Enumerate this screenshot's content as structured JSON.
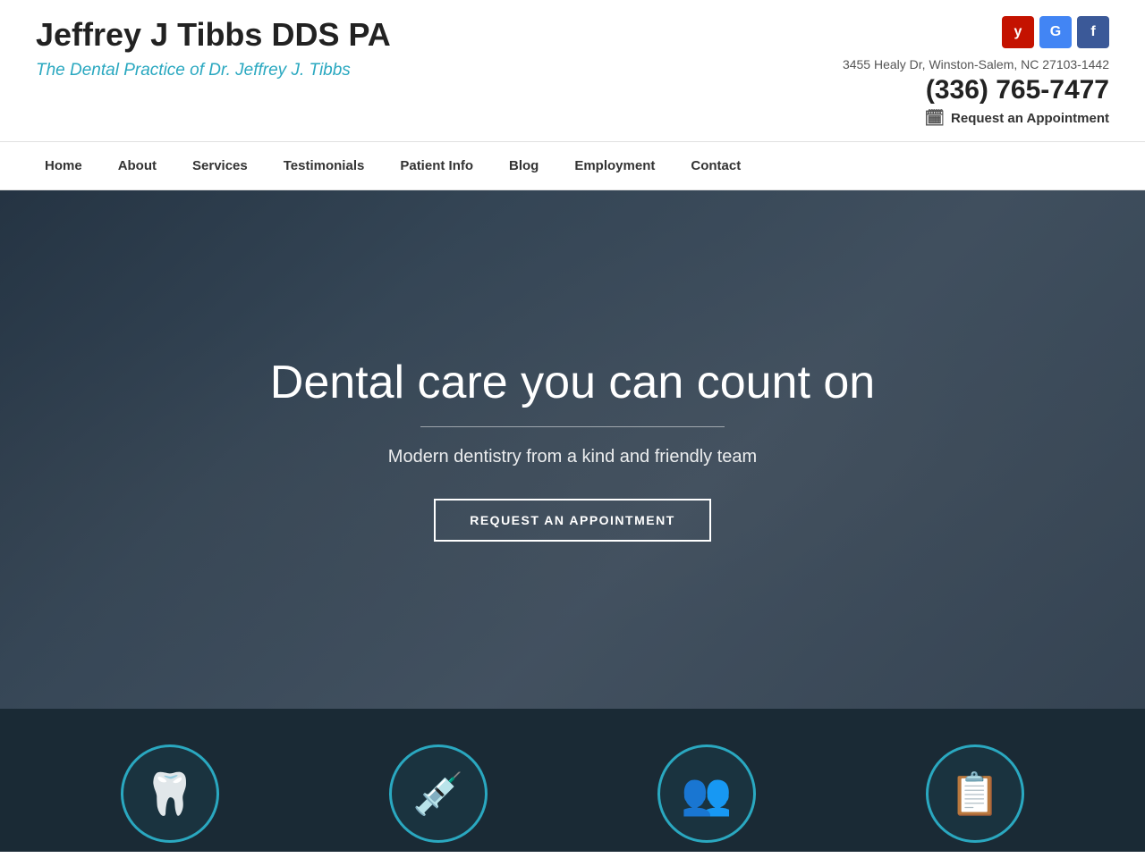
{
  "header": {
    "logo_title": "Jeffrey J Tibbs DDS PA",
    "logo_subtitle": "The Dental Practice of Dr. Jeffrey J. Tibbs",
    "address": "3455 Healy Dr, Winston-Salem, NC 27103-1442",
    "phone": "(336) 765-7477",
    "appointment_label": "Request an Appointment",
    "social": {
      "yelp_label": "y",
      "google_label": "G",
      "facebook_label": "f"
    }
  },
  "nav": {
    "items": [
      {
        "label": "Home"
      },
      {
        "label": "About"
      },
      {
        "label": "Services"
      },
      {
        "label": "Testimonials"
      },
      {
        "label": "Patient Info"
      },
      {
        "label": "Blog"
      },
      {
        "label": "Employment"
      },
      {
        "label": "Contact"
      }
    ]
  },
  "hero": {
    "title": "Dental care you can count on",
    "subtitle": "Modern dentistry from a kind and friendly team",
    "cta_label": "REQUEST AN APPOINTMENT"
  },
  "icons": [
    {
      "symbol": "🦷",
      "name": "tooth-icon"
    },
    {
      "symbol": "💉",
      "name": "needle-icon"
    },
    {
      "symbol": "👥",
      "name": "team-icon"
    },
    {
      "symbol": "📋",
      "name": "clipboard-icon"
    }
  ]
}
